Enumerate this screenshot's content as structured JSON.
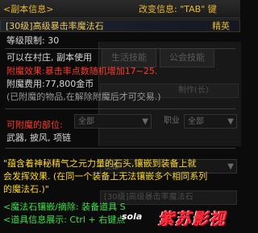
{
  "header": {
    "title": "<副本信息>",
    "change_info": "改变信息: \"TAB\" 键"
  },
  "item": {
    "name": "[30级]高级暴击率魔法石",
    "grade": "精英",
    "level_limit": "等级限制: 30",
    "usage": "可以在村庄, 副本使用",
    "effect": "附魔效果:暴击率点数随机增加17~25.",
    "cost": "附魔费用:77,800金币",
    "note": "(已附魔的物品,在解除附魔后才可交易.)",
    "enchant_parts_label": "可附魔的部位:",
    "enchant_parts": "武器, 披风, 项链",
    "desc_line1": "\"蕴含着神秘精气之元力量的石头,镶嵌到装备上就",
    "desc_line2": "会发挥效果. (在同一个装备上无法镶嵌多个相同系列",
    "desc_line3": "的魔法石.)\"",
    "hint1": "<魔法石镶嵌/摘除: 装备道具 S",
    "hint2": "<道具信息展示: Ctrl + 右键点"
  },
  "background": {
    "tab_life_skill": "生活技能",
    "tab_guild_skill": "公会技能",
    "ghost_row_text": "制作(长)",
    "filter_all_1": "全部",
    "job_label": "职业",
    "filter_all_2": "全部",
    "filter_all_3": "全部",
    "ghost_row2": "[30级]高级暴击率魔法石"
  },
  "watermark": {
    "user": "sola",
    "logo": "紫苏影视"
  },
  "colors": {
    "title_gold": "#e9b82e",
    "grade_gold": "#e9b82e",
    "label_red": "#ff3a2a",
    "desc_yellow": "#ffd92a",
    "hint_green": "#3ee14a"
  }
}
